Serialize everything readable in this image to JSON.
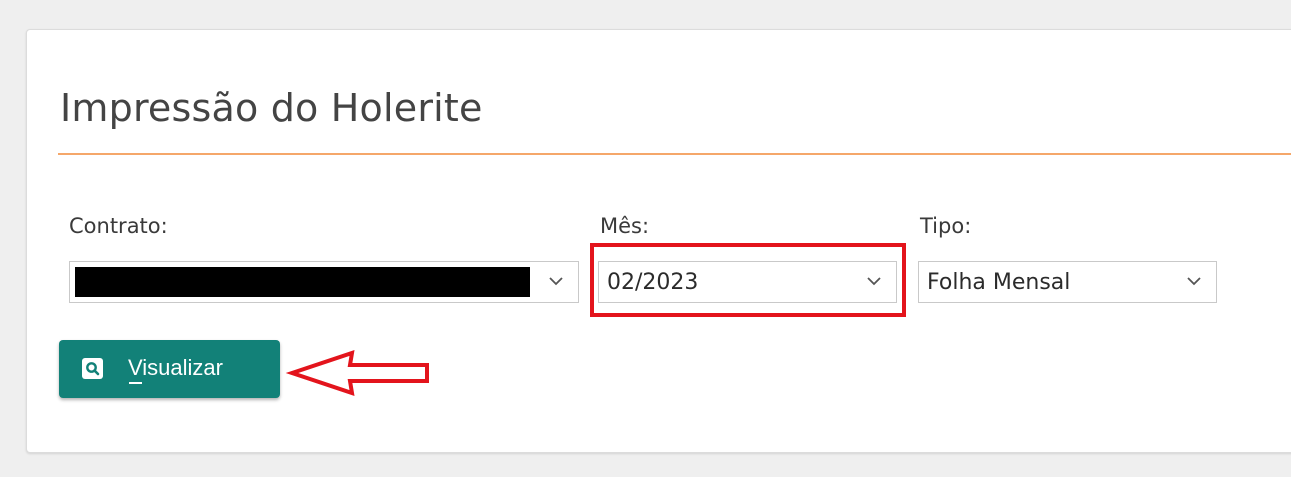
{
  "page": {
    "title": "Impressão do Holerite"
  },
  "form": {
    "contrato": {
      "label": "Contrato:",
      "value": ""
    },
    "mes": {
      "label": "Mês:",
      "value": "02/2023"
    },
    "tipo": {
      "label": "Tipo:",
      "value": "Folha Mensal"
    }
  },
  "actions": {
    "visualizar_label": "Visualizar"
  },
  "annotations": {
    "highlight_color": "#e3141c",
    "arrow_color": "#e3141c"
  },
  "colors": {
    "accent_rule": "#f5a76a",
    "button_bg": "#128178"
  },
  "icons": {
    "dropdown": "chevron-down-icon",
    "button": "search-icon"
  }
}
